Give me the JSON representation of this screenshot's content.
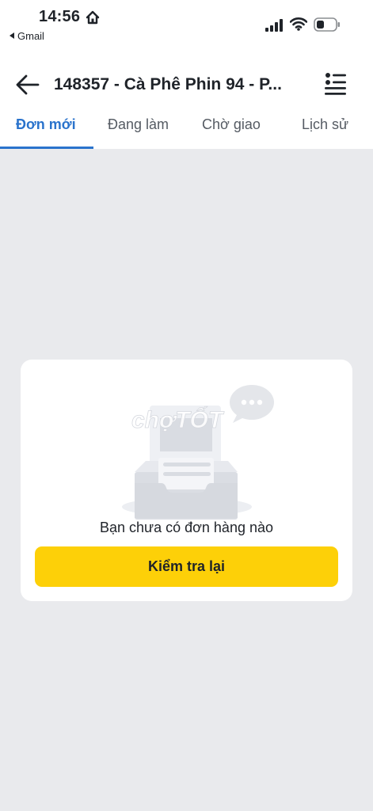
{
  "status_bar": {
    "time": "14:56",
    "back_app": "Gmail"
  },
  "header": {
    "title": "148357 - Cà Phê Phin 94 - P..."
  },
  "tabs": [
    {
      "label": "Đơn mới",
      "active": true
    },
    {
      "label": "Đang làm",
      "active": false
    },
    {
      "label": "Chờ giao",
      "active": false
    },
    {
      "label": "Lịch sử",
      "active": false
    }
  ],
  "empty_state": {
    "message": "Bạn chưa có đơn hàng nào",
    "button_label": "Kiểm tra lại",
    "watermark": "chợTỐT"
  },
  "colors": {
    "accent": "#2a73cc",
    "button": "#fdd008",
    "background": "#e9eaed"
  },
  "icons": {
    "back": "arrow-left-icon",
    "menu": "list-menu-icon",
    "home": "home-icon",
    "illustration": "empty-inbox-icon"
  }
}
